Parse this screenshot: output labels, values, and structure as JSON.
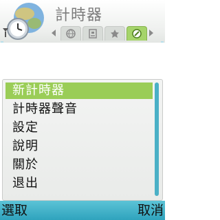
{
  "app": {
    "title": "計時器"
  },
  "tabs": [
    {
      "icon": "globe-icon",
      "active": false
    },
    {
      "icon": "city-time-icon",
      "active": false
    },
    {
      "icon": "star-icon",
      "active": false
    },
    {
      "icon": "stopwatch-icon",
      "active": true
    }
  ],
  "menu": {
    "items": [
      {
        "label": "新計時器",
        "selected": true
      },
      {
        "label": "計時器聲音",
        "selected": false
      },
      {
        "label": "設定",
        "selected": false
      },
      {
        "label": "說明",
        "selected": false
      },
      {
        "label": "關於",
        "selected": false
      },
      {
        "label": "退出",
        "selected": false
      }
    ]
  },
  "softkeys": {
    "left": "選取",
    "right": "取消"
  },
  "colors": {
    "highlight": "#9acd57",
    "softkey_bar": "#3fb1c9",
    "title_text": "#7c7c7c"
  }
}
